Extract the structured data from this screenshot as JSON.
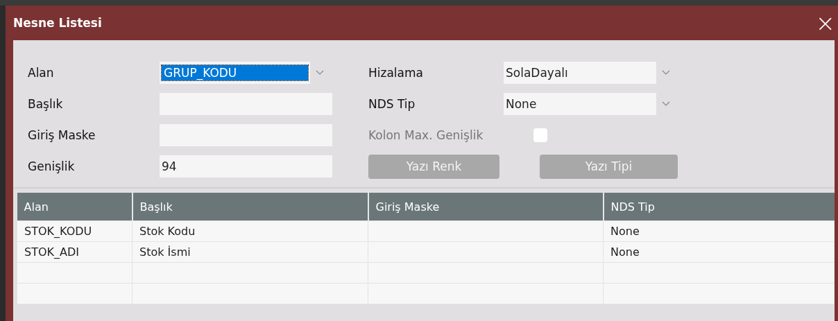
{
  "window": {
    "title": "Nesne Listesi",
    "close": "×"
  },
  "form": {
    "left": [
      {
        "label": "Alan",
        "kind": "select",
        "value": "GRUP_KODU",
        "selected": true
      },
      {
        "label": "Başlık",
        "kind": "text"
      },
      {
        "label": "Giriş Maske",
        "kind": "text"
      },
      {
        "label": "Genişlik",
        "kind": "text",
        "value": "94"
      }
    ],
    "right": [
      {
        "label": "Hizalama",
        "kind": "select",
        "value": "SolaDayalı",
        "disabled": false
      },
      {
        "label": "NDS Tip",
        "kind": "select",
        "value": "None",
        "disabled": false
      },
      {
        "label": "Kolon Max. Genişlik",
        "kind": "checkbox",
        "checked": false,
        "disabled": true
      }
    ],
    "buttons": [
      {
        "label": "Yazı Renk",
        "disabled": true
      },
      {
        "label": "Yazı Tipi",
        "disabled": true
      }
    ]
  },
  "table": {
    "columns": [
      "Alan",
      "Başlık",
      "Giriş Maske",
      "NDS Tip"
    ],
    "rows": [
      [
        "STOK_KODU",
        "Stok Kodu",
        "",
        "None"
      ],
      [
        "STOK_ADI",
        "Stok İsmi",
        "",
        "None"
      ],
      [
        "",
        "",
        "",
        ""
      ],
      [
        "",
        "",
        "",
        ""
      ]
    ]
  }
}
